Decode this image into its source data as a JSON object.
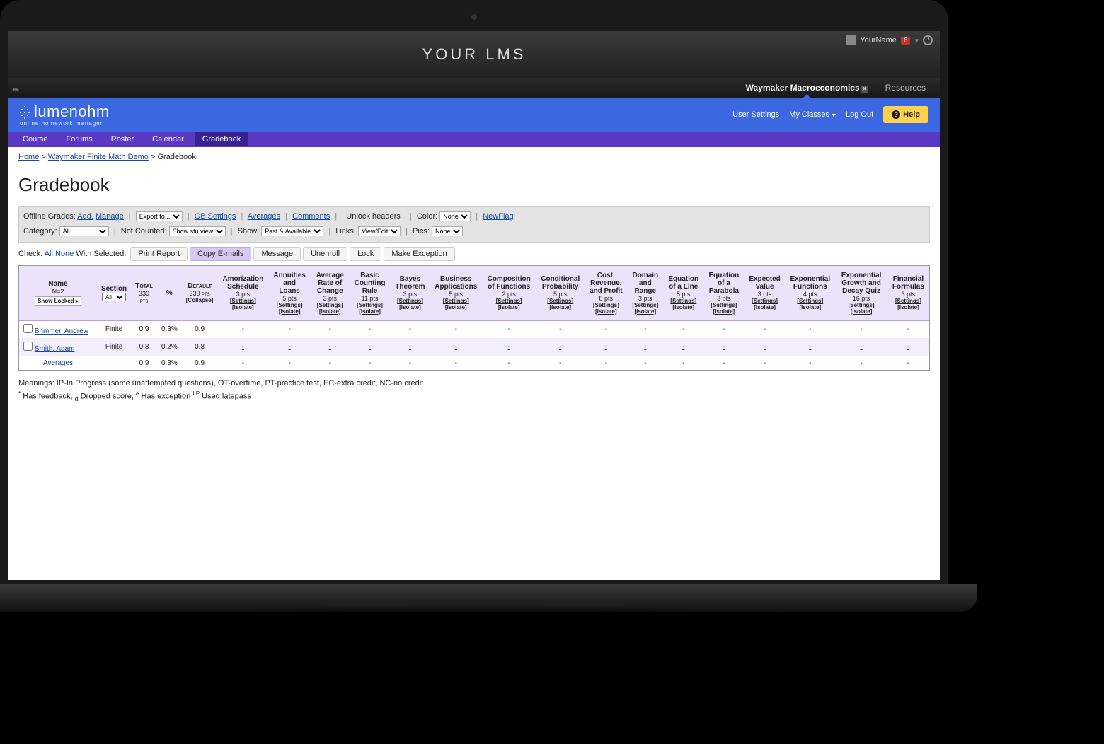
{
  "lms": {
    "title": "YOUR LMS",
    "username": "YourName",
    "badge": "6",
    "tabs": {
      "active": "Waymaker Macroeconomics",
      "other": "Resources"
    }
  },
  "brand": {
    "name": "lumenohm",
    "tagline": "online homework manager"
  },
  "topright": {
    "user_settings": "User Settings",
    "my_classes": "My Classes",
    "log_out": "Log Out",
    "help": "Help"
  },
  "nav": {
    "items": [
      "Course",
      "Forums",
      "Roster",
      "Calendar",
      "Gradebook"
    ],
    "active_index": 4
  },
  "breadcrumb": {
    "home": "Home",
    "course": "Waymaker Finite Math Demo",
    "page": "Gradebook"
  },
  "page_title": "Gradebook",
  "toolbar": {
    "offline_label": "Offline Grades:",
    "add": "Add,",
    "manage": "Manage",
    "export": "Export to...",
    "gb_settings": "GB Settings",
    "averages": "Averages",
    "comments": "Comments",
    "unlock": "Unlock headers",
    "color_label": "Color:",
    "color_val": "None",
    "newflag": "NewFlag",
    "category_label": "Category:",
    "category_val": "All",
    "not_counted_label": "Not Counted:",
    "not_counted_val": "Show stu view",
    "show_label": "Show:",
    "show_val": "Past & Available",
    "links_label": "Links:",
    "links_val": "View/Edit",
    "pics_label": "Pics:",
    "pics_val": "None"
  },
  "actions": {
    "check_label": "Check:",
    "all": "All",
    "none": "None",
    "with_selected": "With Selected:",
    "buttons": [
      "Print Report",
      "Copy E-mails",
      "Message",
      "Unenroll",
      "Lock",
      "Make Exception"
    ],
    "highlight_index": 1
  },
  "headers": {
    "name": "Name",
    "n_count": "N=2",
    "show_locked": "Show Locked ▸",
    "section": "Section",
    "section_sel": "All",
    "total": "Total",
    "total_pts": "330 pts",
    "percent": "%",
    "default": "Default",
    "default_pts": "330 pts",
    "collapse": "[Collapse]",
    "settings": "[Settings]",
    "isolate": "[Isolate]"
  },
  "assignments": [
    {
      "name": "Amorization Schedule",
      "pts": "3 pts"
    },
    {
      "name": "Annuities and Loans",
      "pts": "5 pts"
    },
    {
      "name": "Average Rate of Change",
      "pts": "3 pts"
    },
    {
      "name": "Basic Counting Rule",
      "pts": "11 pts"
    },
    {
      "name": "Bayes Theorem",
      "pts": "3 pts"
    },
    {
      "name": "Business Applications",
      "pts": "5 pts"
    },
    {
      "name": "Composition of Functions",
      "pts": "2 pts"
    },
    {
      "name": "Conditional Probability",
      "pts": "5 pts"
    },
    {
      "name": "Cost, Revenue, and Profit",
      "pts": "8 pts"
    },
    {
      "name": "Domain and Range",
      "pts": "3 pts"
    },
    {
      "name": "Equation of a Line",
      "pts": "5 pts"
    },
    {
      "name": "Equation of a Parabola",
      "pts": "3 pts"
    },
    {
      "name": "Expected Value",
      "pts": "3 pts"
    },
    {
      "name": "Exponential Functions",
      "pts": "4 pts"
    },
    {
      "name": "Exponential Growth and Decay Quiz",
      "pts": "16 pts"
    },
    {
      "name": "Financial Formulas",
      "pts": "3 pts"
    }
  ],
  "rows": [
    {
      "name": "Brimmer, Andrew",
      "section": "Finite",
      "total": "0.9",
      "pct": "0.3%",
      "def": "0.9"
    },
    {
      "name": "Smith, Adam",
      "section": "Finite",
      "total": "0.8",
      "pct": "0.2%",
      "def": "0.8"
    }
  ],
  "averages": {
    "label": "Averages",
    "total": "0.9",
    "pct": "0.3%",
    "def": "0.9"
  },
  "legend": {
    "meanings": "Meanings: IP-In Progress (some unattempted questions), OT-overtime, PT-practice test, EC-extra credit, NC-no credit",
    "star": "Has feedback,",
    "d": "Dropped score,",
    "e": "Has exception",
    "lp": "Used latepass"
  }
}
